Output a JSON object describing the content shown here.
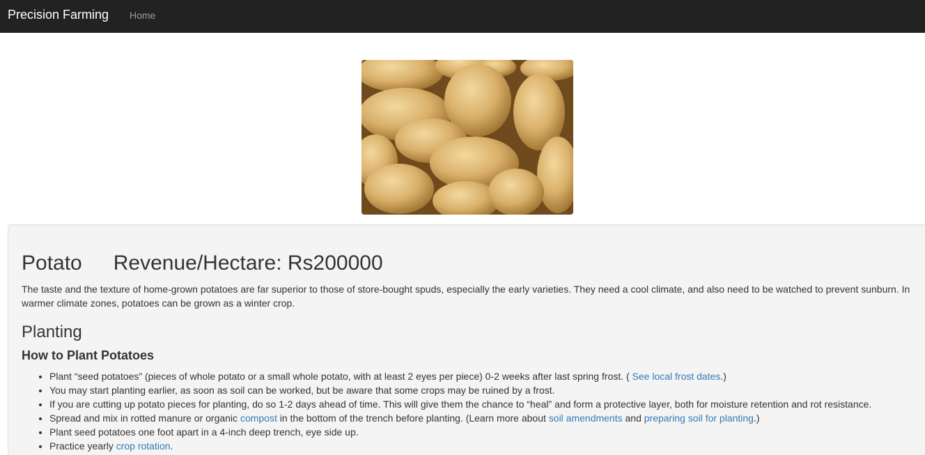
{
  "navbar": {
    "brand": "Precision Farming",
    "links": [
      "Home"
    ]
  },
  "crop": {
    "image_icon": "potatoes-photo",
    "name": "Potato",
    "revenue": "Revenue/Hectare: Rs200000",
    "description": "The taste and the texture of home-grown potatoes are far superior to those of store-bought spuds, especially the early varieties. They need a cool climate, and also need to be watched to prevent sunburn. In warmer climate zones, potatoes can be grown as a winter crop."
  },
  "planting": {
    "heading": "Planting",
    "subheading": "How to Plant Potatoes",
    "steps": [
      {
        "t1": "Plant “seed potatoes” (pieces of whole potato or a small whole potato, with at least 2 eyes per piece) 0-2 weeks after last spring frost. ( ",
        "link1": "See local frost dates",
        "t2": ".)"
      },
      {
        "t1": "You may start planting earlier, as soon as soil can be worked, but be aware that some crops may be ruined by a frost."
      },
      {
        "t1": "If you are cutting up potato pieces for planting, do so 1-2 days ahead of time. This will give them the chance to “heal” and form a protective layer, both for moisture retention and rot resistance."
      },
      {
        "t1": "Spread and mix in rotted manure or organic ",
        "link1": "compost",
        "t2": " in the bottom of the trench before planting. (Learn more about ",
        "link2": "soil amendments",
        "t3": " and ",
        "link3": "preparing soil for planting",
        "t4": ".)"
      },
      {
        "t1": "Plant seed potatoes one foot apart in a 4-inch deep trench, eye side up."
      },
      {
        "t1": "Practice yearly ",
        "link1": "crop rotation",
        "t2": "."
      }
    ]
  },
  "colors": {
    "navbar_bg": "#222222",
    "brand": "#ffffff",
    "nav_link": "#9d9d9d",
    "well_bg": "#f4f4f4",
    "link": "#337ab7",
    "text": "#333333"
  }
}
